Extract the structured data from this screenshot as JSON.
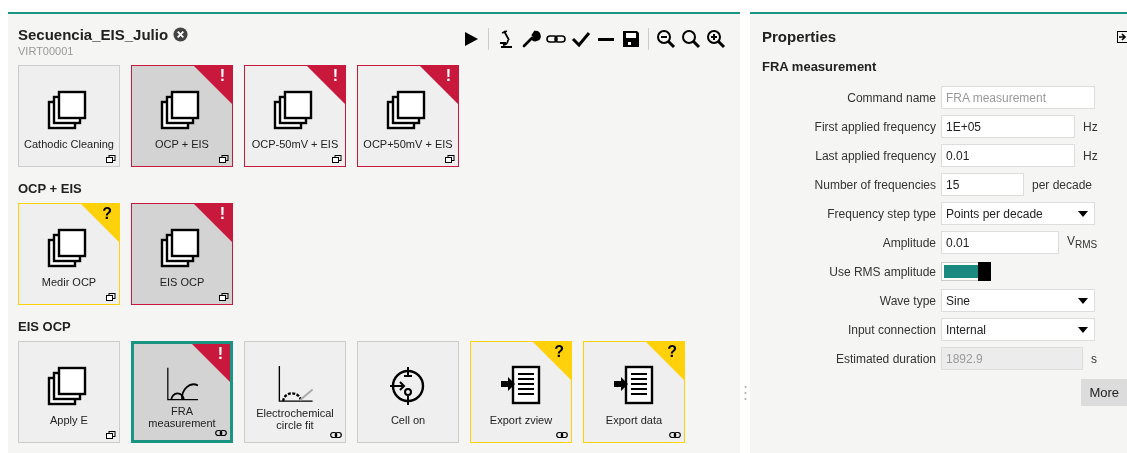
{
  "sequence": {
    "title": "Secuencia_EIS_Julio",
    "subtitle": "VIRT00001"
  },
  "sections": [
    {
      "tiles": [
        {
          "label": "Cathodic Cleaning",
          "kind": "stack",
          "selected": false,
          "focused": false,
          "footer": {
            "kind": "window"
          }
        },
        {
          "label": "OCP + EIS",
          "kind": "stack",
          "badge": {
            "kind": "error",
            "text": "!"
          },
          "selected": true,
          "focused": false,
          "footer": {
            "kind": "window"
          }
        },
        {
          "label": "OCP-50mV + EIS",
          "kind": "stack",
          "badge": {
            "kind": "error",
            "text": "!"
          },
          "selected": false,
          "focused": false,
          "footer": {
            "kind": "window"
          }
        },
        {
          "label": "OCP+50mV + EIS",
          "kind": "stack",
          "badge": {
            "kind": "error",
            "text": "!"
          },
          "selected": false,
          "focused": false,
          "footer": {
            "kind": "window"
          }
        }
      ]
    },
    {
      "title": "OCP + EIS",
      "tiles": [
        {
          "label": "Medir OCP",
          "kind": "stack",
          "badge": {
            "kind": "warning",
            "text": "?"
          },
          "selected": false,
          "focused": false,
          "footer": {
            "kind": "window"
          }
        },
        {
          "label": "EIS OCP",
          "kind": "stack",
          "badge": {
            "kind": "error",
            "text": "!"
          },
          "selected": true,
          "focused": false,
          "footer": {
            "kind": "window"
          }
        }
      ]
    },
    {
      "title": "EIS OCP",
      "tiles": [
        {
          "label": "Apply E",
          "kind": "stack",
          "selected": false,
          "focused": false,
          "footer": {
            "kind": "window"
          }
        },
        {
          "label": "FRA measurement",
          "kind": "nyquist",
          "badge": {
            "kind": "error",
            "text": "!"
          },
          "selected": true,
          "focused": true,
          "footer": {
            "kind": "link"
          }
        },
        {
          "label": "Electrochemical circle fit",
          "kind": "circlefit",
          "selected": false,
          "focused": false,
          "footer": {
            "kind": "link"
          }
        },
        {
          "label": "Cell on",
          "kind": "cell",
          "selected": false,
          "focused": false
        },
        {
          "label": "Export zview",
          "kind": "export",
          "badge": {
            "kind": "warning",
            "text": "?"
          },
          "selected": false,
          "focused": false,
          "footer": {
            "kind": "link"
          }
        },
        {
          "label": "Export data",
          "kind": "export",
          "badge": {
            "kind": "warning",
            "text": "?"
          },
          "selected": false,
          "focused": false,
          "footer": {
            "kind": "link"
          }
        }
      ]
    }
  ],
  "properties": {
    "title": "Properties",
    "subtitle": "FRA measurement",
    "rows": [
      {
        "kind": "text",
        "label": "Command name",
        "value": "FRA measurement",
        "disabled": true
      },
      {
        "kind": "text",
        "label": "First applied frequency",
        "value": "1E+05",
        "unit": "Hz",
        "disabled": false
      },
      {
        "kind": "text",
        "label": "Last applied frequency",
        "value": "0.01",
        "unit": "Hz",
        "disabled": false
      },
      {
        "kind": "text",
        "label": "Number of frequencies",
        "value": "15",
        "unit": "per decade",
        "disabled": false
      },
      {
        "kind": "select",
        "label": "Frequency step type",
        "value": "Points per decade"
      },
      {
        "kind": "text",
        "label": "Amplitude",
        "value": "0.01",
        "unit": "V$_{RMS}$",
        "disabled": false
      },
      {
        "kind": "toggle",
        "label": "Use RMS amplitude",
        "on": true
      },
      {
        "kind": "select",
        "label": "Wave type",
        "value": "Sine"
      },
      {
        "kind": "select",
        "label": "Input connection",
        "value": "Internal"
      },
      {
        "kind": "readonly",
        "label": "Estimated duration",
        "value": "1892.9",
        "unit": "s"
      }
    ],
    "more_button": "More"
  }
}
